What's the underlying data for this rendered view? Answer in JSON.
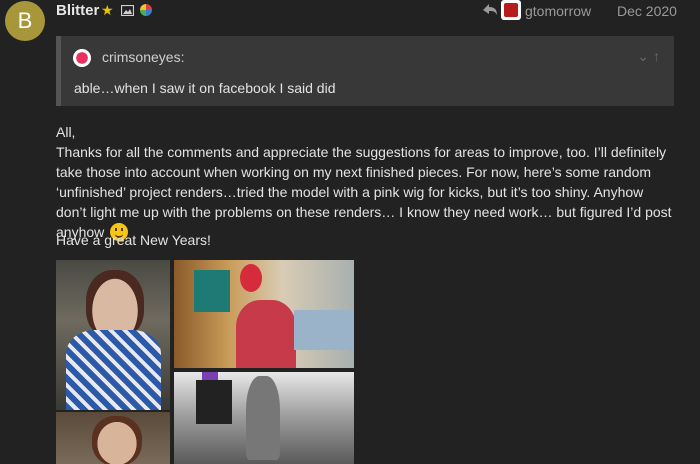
{
  "post": {
    "avatar_letter": "B",
    "username": "Blitter",
    "reply_to_user": "gtomorrow",
    "date": "Dec 2020"
  },
  "quote": {
    "author": "crimsoneyes:",
    "text": "able…when I saw it on facebook I said did"
  },
  "body": {
    "greeting": "All,",
    "paragraph": "Thanks for all the comments and appreciate the suggestions for areas to improve, too. I’ll definitely take those into account when working on my next finished pieces. For now, here’s some random ‘unfinished’ project renders…tried the model with a pink wig for kicks, but it’s too shiny. Anyhow don’t light me up with the problems on these renders… I know they need work… but figured I’d post anyhow",
    "closing": "Have a great New Years!"
  },
  "icons": {
    "star": "star-icon",
    "image": "image-icon",
    "globe": "globe-icon",
    "reply": "reply-arrow-icon",
    "quote_expand": "chevron-down-icon",
    "quote_jump": "arrow-up-icon",
    "smile": "smile-emoji-icon"
  },
  "colors": {
    "background": "#222222",
    "avatar": "#a8973a",
    "quote_bg": "#383838",
    "star": "#e8c200"
  }
}
